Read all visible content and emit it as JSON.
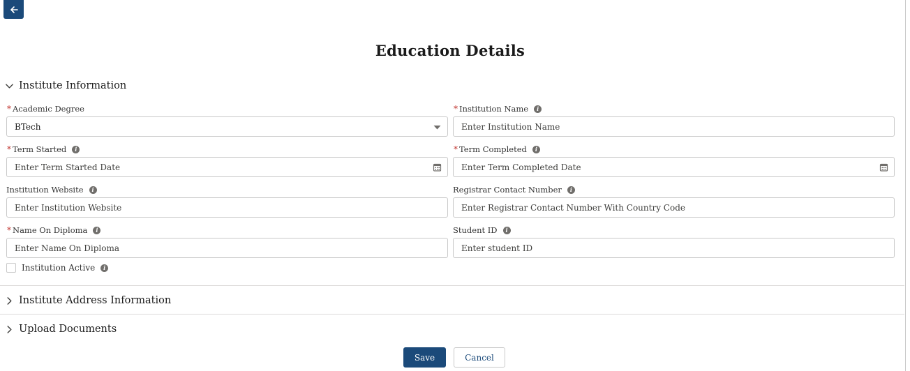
{
  "page": {
    "title": "Education Details"
  },
  "sections": {
    "institute": {
      "label": "Institute Information",
      "expanded": true
    },
    "address": {
      "label": "Institute Address Information",
      "expanded": false
    },
    "uploads": {
      "label": "Upload Documents",
      "expanded": false
    }
  },
  "fields": {
    "academic_degree": {
      "label": "Academic Degree",
      "required": true,
      "value": "BTech"
    },
    "institution_name": {
      "label": "Institution Name",
      "required": true,
      "placeholder": "Enter Institution Name"
    },
    "term_started": {
      "label": "Term Started",
      "required": true,
      "placeholder": "Enter Term Started Date"
    },
    "term_completed": {
      "label": "Term Completed",
      "required": true,
      "placeholder": "Enter Term Completed Date"
    },
    "institution_website": {
      "label": "Institution Website",
      "required": false,
      "placeholder": "Enter Institution Website"
    },
    "registrar_contact": {
      "label": "Registrar Contact Number",
      "required": false,
      "placeholder": "Enter Registrar Contact Number With Country Code"
    },
    "name_on_diploma": {
      "label": "Name On Diploma",
      "required": true,
      "placeholder": "Enter Name On Diploma"
    },
    "student_id": {
      "label": "Student ID",
      "required": false,
      "placeholder": "Enter student ID"
    },
    "institution_active": {
      "label": "Institution Active",
      "checked": false
    }
  },
  "required_marker": "*",
  "info_glyph": "i",
  "actions": {
    "save_label": "Save",
    "cancel_label": "Cancel"
  },
  "colors": {
    "brand": "#1b4a7a",
    "required": "#c23934",
    "border": "#c9c9c9"
  },
  "icons": {
    "back": "arrow-left-icon",
    "dropdown": "caret-down-icon",
    "calendar": "calendar-icon",
    "info": "info-icon",
    "expanded": "chevron-down-icon",
    "collapsed": "chevron-right-icon"
  }
}
